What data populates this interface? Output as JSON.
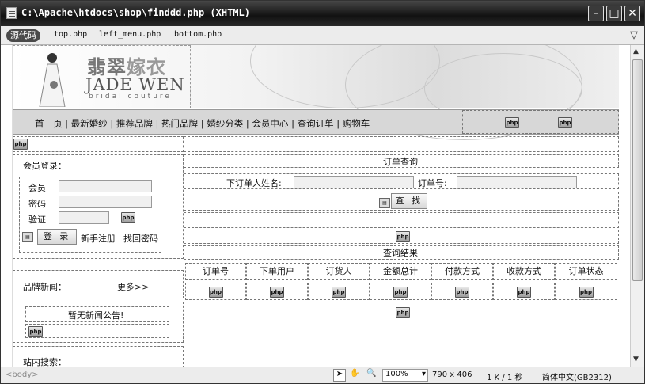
{
  "window": {
    "title": "C:\\Apache\\htdocs\\shop\\finddd.php (XHTML)"
  },
  "tabbar": {
    "source_label": "源代码",
    "related_files": [
      "top.php",
      "left_menu.php",
      "bottom.php"
    ]
  },
  "header": {
    "logo_cn_a": "翡翠",
    "logo_cn_b": "嫁衣",
    "logo_en": "JADE WEN",
    "logo_sub": "bridal couture"
  },
  "nav": {
    "items": [
      "首　页",
      "最新婚纱",
      "推荐品牌",
      "热门品牌",
      "婚纱分类",
      "会员中心",
      "查询订单",
      "购物车"
    ],
    "php_tag": "php"
  },
  "login": {
    "title": "会员登录：",
    "member_label": "会员",
    "password_label": "密码",
    "verify_label": "验证",
    "login_button": "登 录",
    "register_link": "新手注册",
    "recover_link": "找回密码"
  },
  "brand_news": {
    "title": "品牌新闻：",
    "more_link": "更多>>",
    "empty_notice": "暂无新闻公告!"
  },
  "site_search": {
    "title": "站内搜索："
  },
  "order_query": {
    "title": "订单查询",
    "name_label": "下订单人姓名:",
    "order_no_label": "订单号:",
    "search_button": "查 找",
    "results_title": "查询结果"
  },
  "results_table": {
    "headers": [
      "订单号",
      "下单用户",
      "订货人",
      "金额总计",
      "付款方式",
      "收款方式",
      "订单状态"
    ]
  },
  "statusbar": {
    "tag": "<body>",
    "zoom": "100%",
    "dimensions": "790 x 406",
    "size_time": "1 K / 1 秒",
    "encoding": "简体中文(GB2312)"
  }
}
